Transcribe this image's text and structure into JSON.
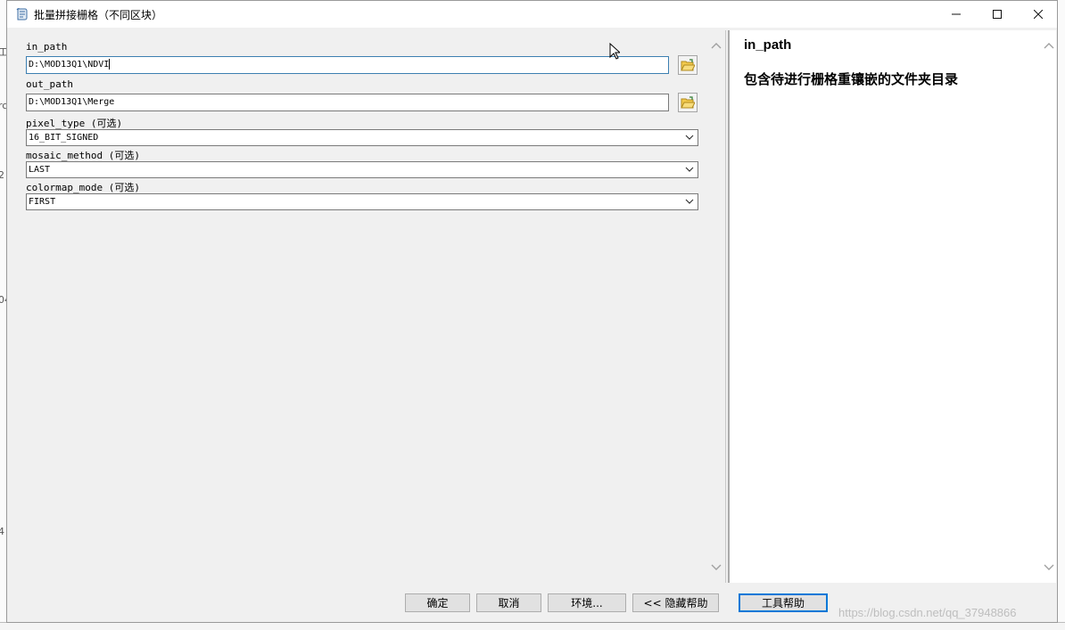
{
  "window": {
    "title": "批量拼接栅格（不同区块）",
    "controls": {
      "minimize": "minimize",
      "maximize": "maximize",
      "close": "close"
    }
  },
  "params": {
    "in_path": {
      "label": "in_path",
      "value": "D:\\MOD13Q1\\NDVI"
    },
    "out_path": {
      "label": "out_path",
      "value": "D:\\MOD13Q1\\Merge"
    },
    "pixel_type": {
      "label": "pixel_type (可选)",
      "value": "16_BIT_SIGNED"
    },
    "mosaic_method": {
      "label": "mosaic_method (可选)",
      "value": "LAST"
    },
    "colormap_mode": {
      "label": "colormap_mode (可选)",
      "value": "FIRST"
    }
  },
  "help": {
    "title": "in_path",
    "description": "包含待进行栅格重镶嵌的文件夹目录"
  },
  "footer": {
    "ok": "确定",
    "cancel": "取消",
    "environments": "环境...",
    "hide_help": "<< 隐藏帮助",
    "tool_help": "工具帮助"
  },
  "watermark": "https://blog.csdn.net/qq_37948866",
  "background_fragments": [
    "工",
    "rc",
    "2",
    "04",
    "4"
  ],
  "colors": {
    "accent": "#0078d7",
    "focus_border": "#3c7fb1"
  }
}
